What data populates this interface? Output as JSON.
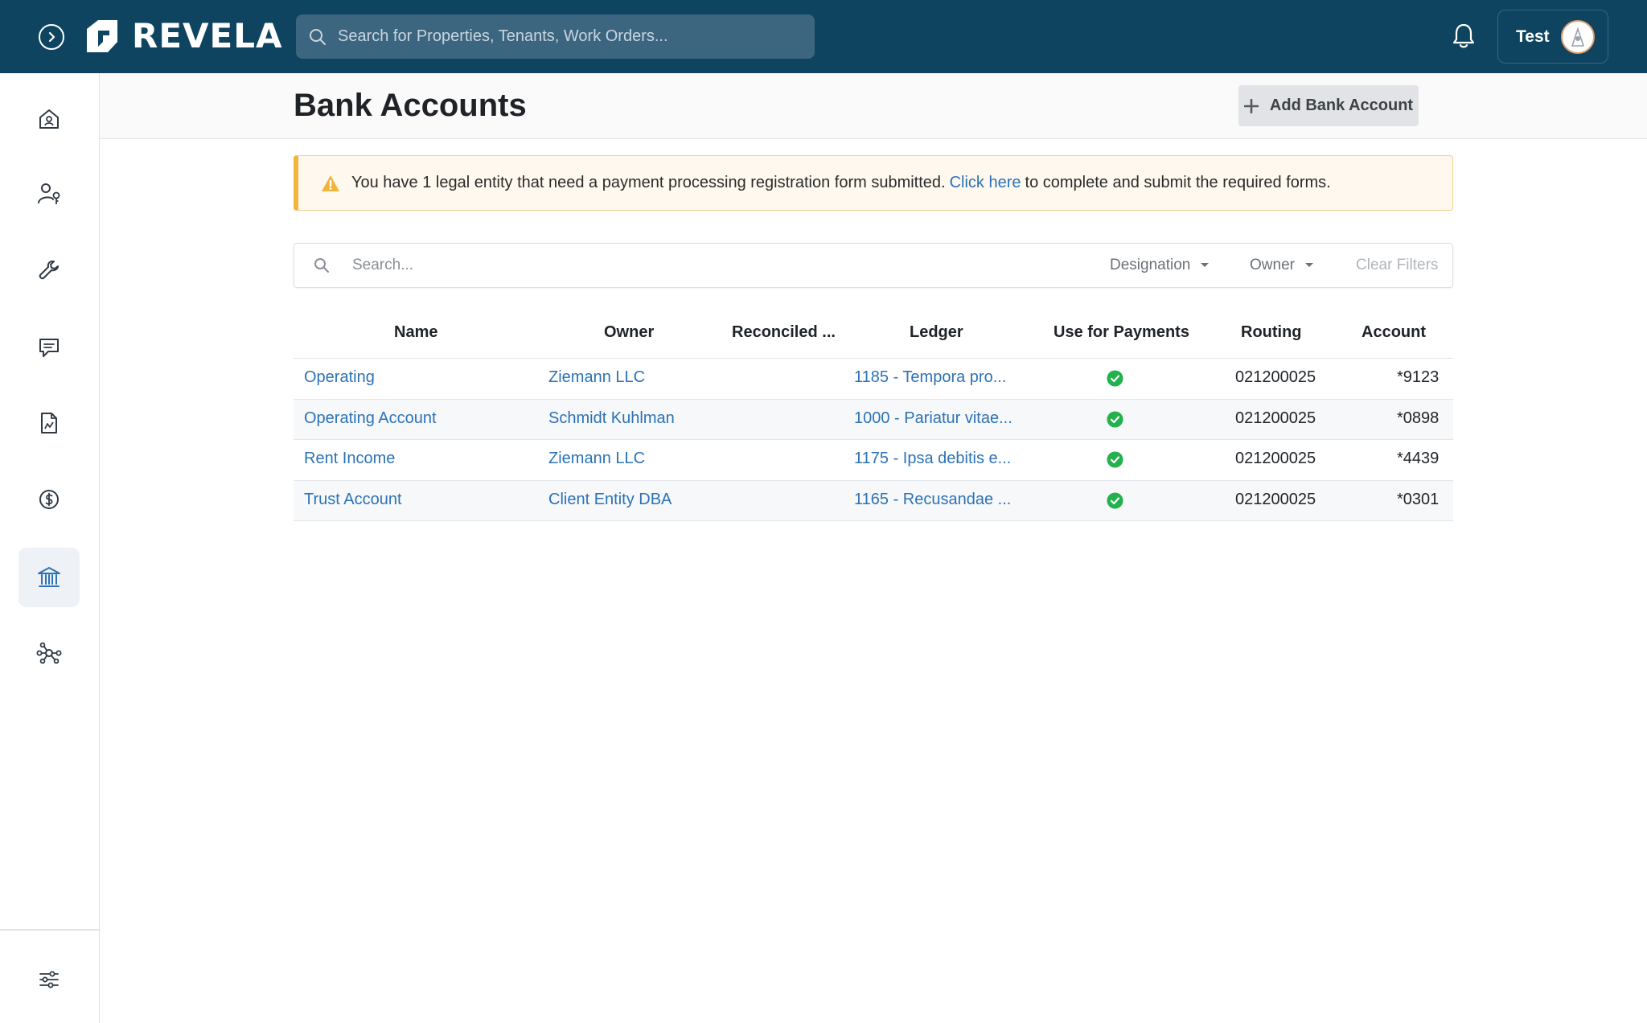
{
  "app": {
    "brand": "REVELA",
    "search_placeholder": "Search for Properties, Tenants, Work Orders...",
    "user_name": "Test"
  },
  "sidebar": {
    "items": [
      {
        "name": "home-icon",
        "active": false
      },
      {
        "name": "people-icon",
        "active": false
      },
      {
        "name": "wrench-icon",
        "active": false
      },
      {
        "name": "chat-icon",
        "active": false
      },
      {
        "name": "document-icon",
        "active": false
      },
      {
        "name": "dollar-icon",
        "active": false
      },
      {
        "name": "bank-icon",
        "active": true
      },
      {
        "name": "network-icon",
        "active": false
      }
    ],
    "bottom_item": "settings-sliders-icon"
  },
  "page": {
    "title": "Bank Accounts",
    "add_button": "Add Bank Account"
  },
  "alert": {
    "text_before": "You have 1 legal entity that need a payment processing registration form submitted.",
    "link_text": "Click here",
    "text_after": "to complete and submit the required forms."
  },
  "filters": {
    "search_placeholder": "Search...",
    "designation": "Designation",
    "owner": "Owner",
    "clear": "Clear Filters"
  },
  "table": {
    "columns": {
      "name": "Name",
      "owner": "Owner",
      "reconciled": "Reconciled ...",
      "ledger": "Ledger",
      "use_for_payments": "Use for Payments",
      "routing": "Routing",
      "account": "Account"
    },
    "rows": [
      {
        "name": "Operating",
        "owner": "Ziemann LLC",
        "ledger": "1185 - Tempora pro...",
        "use_for_payments": true,
        "routing": "021200025",
        "account": "*9123"
      },
      {
        "name": "Operating Account",
        "owner": "Schmidt Kuhlman",
        "ledger": "1000 - Pariatur vitae...",
        "use_for_payments": true,
        "routing": "021200025",
        "account": "*0898"
      },
      {
        "name": "Rent Income",
        "owner": "Ziemann LLC",
        "ledger": "1175 - Ipsa debitis e...",
        "use_for_payments": true,
        "routing": "021200025",
        "account": "*4439"
      },
      {
        "name": "Trust Account",
        "owner": "Client Entity DBA",
        "ledger": "1165 - Recusandae ...",
        "use_for_payments": true,
        "routing": "021200025",
        "account": "*0301"
      }
    ]
  },
  "colors": {
    "topbar": "#0f4460",
    "link": "#2c72b6",
    "success": "#22b14c",
    "warning": "#f1b53a"
  }
}
